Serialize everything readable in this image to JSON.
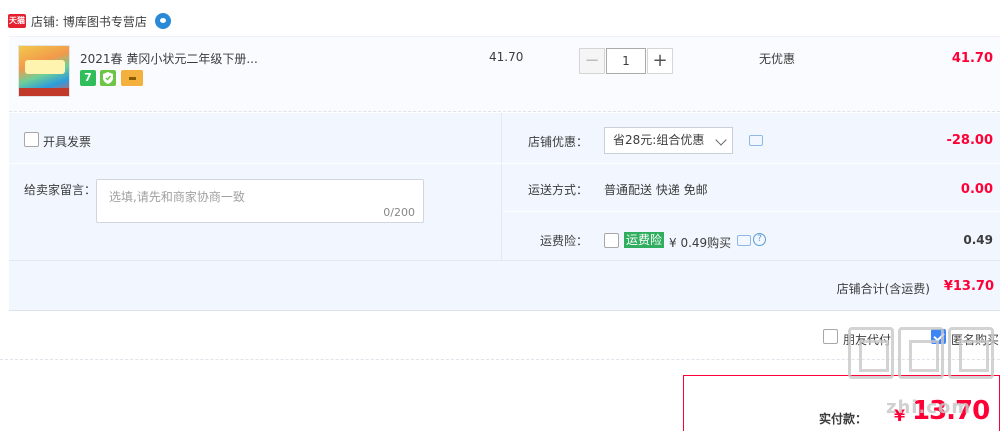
{
  "shop": {
    "badge": "天猫",
    "name": "店铺: 博库图书专营店"
  },
  "item": {
    "title": "2021春 黄冈小状元二年级下册...",
    "service_icons": [
      "7-day-return-icon",
      "shield-icon",
      "credit-card-icon"
    ],
    "service_7_label": "7",
    "unit_price": "41.70",
    "quantity": "1",
    "minus_label": "−",
    "plus_label": "+",
    "discount": "无优惠",
    "subtotal": "41.70"
  },
  "invoice": {
    "label": "开具发票",
    "checked": false
  },
  "message": {
    "label": "给卖家留言：",
    "placeholder": "选填,请先和商家协商一致",
    "count": "0/200"
  },
  "shop_discount": {
    "label": "店铺优惠：",
    "selected": "省28元:组合优惠",
    "amount": "-28.00"
  },
  "shipping": {
    "label": "运送方式：",
    "value": "普通配送 快递 免邮",
    "amount": "0.00"
  },
  "insurance": {
    "label": "运费险：",
    "tag": "运费险",
    "price_text": "¥ 0.49购买",
    "help_label": "?",
    "amount": "0.49",
    "checked": false
  },
  "shop_total": {
    "label": "店铺合计(含运费)",
    "value": "¥13.70"
  },
  "options": {
    "friend_pay": {
      "label": "朋友代付",
      "checked": false
    },
    "anonymous": {
      "label": "匿名购买",
      "checked": true
    }
  },
  "payment": {
    "label": "实付款：",
    "symbol": "¥",
    "value": "13.70"
  },
  "watermark": {
    "text": "zhi.com"
  },
  "colors": {
    "accent_red": "#ff0036",
    "panel_blue": "#f2f7ff",
    "checkbox_blue": "#3d86f5",
    "tag_green": "#2fae5f"
  }
}
